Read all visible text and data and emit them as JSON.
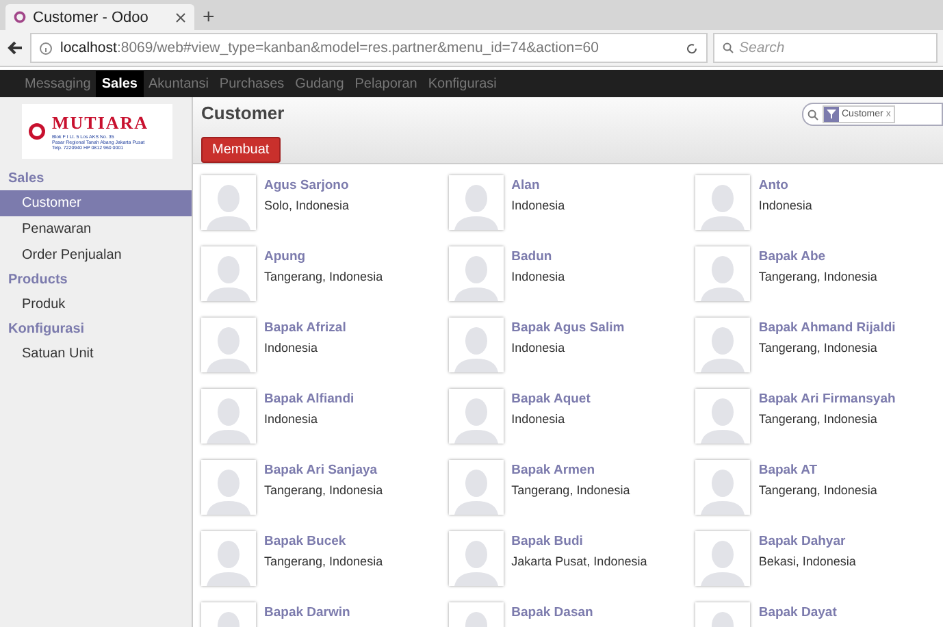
{
  "browser": {
    "tab_title": "Customer - Odoo",
    "new_tab": "+",
    "url_host": "localhost",
    "url_rest": ":8069/web#view_type=kanban&model=res.partner&menu_id=74&action=60",
    "search_placeholder": "Search"
  },
  "top_menu": [
    {
      "label": "Messaging",
      "selected": false
    },
    {
      "label": "Sales",
      "selected": true
    },
    {
      "label": "Akuntansi",
      "selected": false
    },
    {
      "label": "Purchases",
      "selected": false
    },
    {
      "label": "Gudang",
      "selected": false
    },
    {
      "label": "Pelaporan",
      "selected": false
    },
    {
      "label": "Konfigurasi",
      "selected": false
    }
  ],
  "logo": {
    "name": "MUTIARA",
    "lines": [
      "Blok F I Lt. 5 Los AKS No. 35",
      "Pasar Regional Tanah Abang Jakarta Pusat",
      "Telp. 7220940 HP 0812 960 0001"
    ]
  },
  "sidebar": [
    {
      "heading": "Sales",
      "items": [
        {
          "label": "Customer",
          "selected": true
        },
        {
          "label": "Penawaran",
          "selected": false
        },
        {
          "label": "Order Penjualan",
          "selected": false
        }
      ]
    },
    {
      "heading": "Products",
      "items": [
        {
          "label": "Produk",
          "selected": false
        }
      ]
    },
    {
      "heading": "Konfigurasi",
      "items": [
        {
          "label": "Satuan Unit",
          "selected": false
        }
      ]
    }
  ],
  "page": {
    "title": "Customer",
    "create_button": "Membuat",
    "filter_tag": "Customer",
    "filter_remove": "x"
  },
  "cards": [
    {
      "name": "Agus Sarjono",
      "location": "Solo, Indonesia"
    },
    {
      "name": "Alan",
      "location": "Indonesia"
    },
    {
      "name": "Anto",
      "location": "Indonesia"
    },
    {
      "name": "Apung",
      "location": "Tangerang, Indonesia"
    },
    {
      "name": "Badun",
      "location": "Indonesia"
    },
    {
      "name": "Bapak Abe",
      "location": "Tangerang, Indonesia"
    },
    {
      "name": "Bapak Afrizal",
      "location": "Indonesia"
    },
    {
      "name": "Bapak Agus Salim",
      "location": "Indonesia"
    },
    {
      "name": "Bapak Ahmand Rijaldi",
      "location": "Tangerang, Indonesia"
    },
    {
      "name": "Bapak Alfiandi",
      "location": "Indonesia"
    },
    {
      "name": "Bapak Aquet",
      "location": "Indonesia"
    },
    {
      "name": "Bapak Ari Firmansyah",
      "location": "Tangerang, Indonesia"
    },
    {
      "name": "Bapak Ari Sanjaya",
      "location": "Tangerang, Indonesia"
    },
    {
      "name": "Bapak Armen",
      "location": "Tangerang, Indonesia"
    },
    {
      "name": "Bapak AT",
      "location": "Tangerang, Indonesia"
    },
    {
      "name": "Bapak Bucek",
      "location": "Tangerang, Indonesia"
    },
    {
      "name": "Bapak Budi",
      "location": "Jakarta Pusat, Indonesia"
    },
    {
      "name": "Bapak Dahyar",
      "location": "Bekasi, Indonesia"
    },
    {
      "name": "Bapak Darwin"
    },
    {
      "name": "Bapak Dasan"
    },
    {
      "name": "Bapak Dayat"
    }
  ]
}
